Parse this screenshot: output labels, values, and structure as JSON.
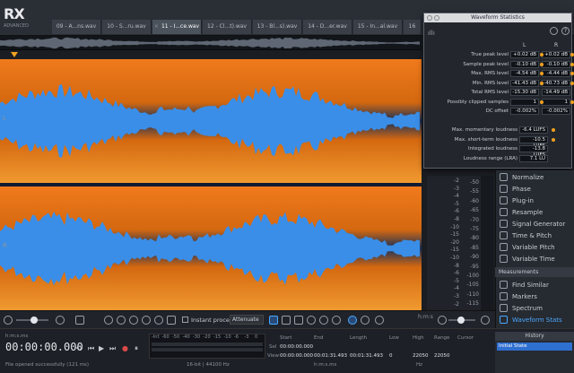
{
  "app": {
    "logo_text": "RX",
    "logo_sub": "ADVANCED"
  },
  "tabs": [
    {
      "label": "09 - A...ns.wav",
      "active": false
    },
    {
      "label": "10 - S...ru.wav",
      "active": false
    },
    {
      "label": "11 - I...ce.wav",
      "active": true
    },
    {
      "label": "12 - Cl...t).wav",
      "active": false
    },
    {
      "label": "13 - Bl...s).wav",
      "active": false
    },
    {
      "label": "14 - D...er.wav",
      "active": false
    },
    {
      "label": "15 - In...al.wav",
      "active": false
    },
    {
      "label": "16",
      "active": false
    }
  ],
  "channels": {
    "left": "L",
    "right": "R"
  },
  "colors": {
    "spectrogram_bg": "#0d1b33",
    "waveform": "#3a8ee8",
    "spectrogram_hot": "#f08020",
    "accent": "#4aa8ff",
    "marker": "#f0a020"
  },
  "stats": {
    "title": "Waveform Statistics",
    "col_l": "L",
    "col_r": "R",
    "rows": [
      {
        "label": "True peak level",
        "l": "+0.02 dB",
        "r": "+0.02 dB"
      },
      {
        "label": "Sample peak level",
        "l": "-0.10 dB",
        "r": "-0.10 dB"
      },
      {
        "label": "Max. RMS level",
        "l": "-4.54 dB",
        "r": "-4.44 dB"
      },
      {
        "label": "Min. RMS level",
        "l": "-41.43 dB",
        "r": "-40.73 dB"
      },
      {
        "label": "Total RMS level",
        "l": "-15.30 dB",
        "r": "-14.49 dB"
      },
      {
        "label": "Possibly clipped samples",
        "l": "1",
        "r": "1"
      },
      {
        "label": "DC offset",
        "l": "-0.002%",
        "r": "-0.002%"
      }
    ],
    "loudness": [
      {
        "label": "Max. momentary loudness",
        "value": "-6.4 LUFS"
      },
      {
        "label": "Max. short-term loudness",
        "value": "-10.5 LUFS"
      },
      {
        "label": "Integrated loudness",
        "value": "-13.8 LUFS"
      },
      {
        "label": "Loudness range (LRA)",
        "value": "7.1 LU"
      }
    ]
  },
  "db_scale": [
    "-2",
    "-3",
    "-4",
    "-5",
    "-6",
    "-8",
    "-10",
    "-15",
    "-20",
    "-15",
    "-10",
    "-8",
    "-6",
    "-5",
    "-4",
    "-3",
    "-2"
  ],
  "hz_scale": [
    "-50",
    "-55",
    "-60",
    "-65",
    "-70",
    "-75",
    "-80",
    "-85",
    "-90",
    "-95",
    "-100",
    "-105",
    "-110",
    "-115"
  ],
  "modules": [
    {
      "label": "Normalize",
      "icon": "normalize-icon"
    },
    {
      "label": "Phase",
      "icon": "phase-icon"
    },
    {
      "label": "Plug-in",
      "icon": "plugin-icon"
    },
    {
      "label": "Resample",
      "icon": "resample-icon"
    },
    {
      "label": "Signal Generator",
      "icon": "signal-generator-icon"
    },
    {
      "label": "Time & Pitch",
      "icon": "time-pitch-icon"
    },
    {
      "label": "Variable Pitch",
      "icon": "variable-pitch-icon"
    },
    {
      "label": "Variable Time",
      "icon": "variable-time-icon"
    }
  ],
  "measurements_section": "Measurements",
  "measurements": [
    {
      "label": "Find Similar",
      "icon": "find-similar-icon",
      "active": false
    },
    {
      "label": "Markers",
      "icon": "markers-icon",
      "active": false
    },
    {
      "label": "Spectrum",
      "icon": "spectrum-icon",
      "active": false
    },
    {
      "label": "Waveform Stats",
      "icon": "waveform-stats-icon",
      "active": true
    }
  ],
  "toolbar": {
    "instant_process": "Instant process",
    "mode": "Attenuate",
    "time_unit": "h:m:s"
  },
  "transport": {
    "time_unit": "h:m:s.ms",
    "timecode": "00:00:00.000",
    "status": "File opened successfully (121 ms)",
    "format": "16-bit | 44100 Hz"
  },
  "selection": {
    "headers": {
      "start": "Start",
      "end": "End",
      "length": "Length",
      "low": "Low",
      "high": "High",
      "range": "Range",
      "cursor": "Cursor"
    },
    "sel_label": "Sel",
    "view_label": "View",
    "sel_start": "00:00:00.000",
    "view_start": "00:00:00.000",
    "view_end": "00:01:31.493",
    "view_length": "00:01:31.493",
    "low": "0",
    "high": "22050",
    "range": "22050",
    "time_unit": "h:m:s.ms",
    "freq_unit": "Hz"
  },
  "history": {
    "title": "History",
    "items": [
      "Initial State"
    ]
  },
  "level_ticks": [
    "-Inf.",
    "-60",
    "-50",
    "-40",
    "-30",
    "-20",
    "-15",
    "-10",
    "-6",
    "-3",
    "0"
  ]
}
